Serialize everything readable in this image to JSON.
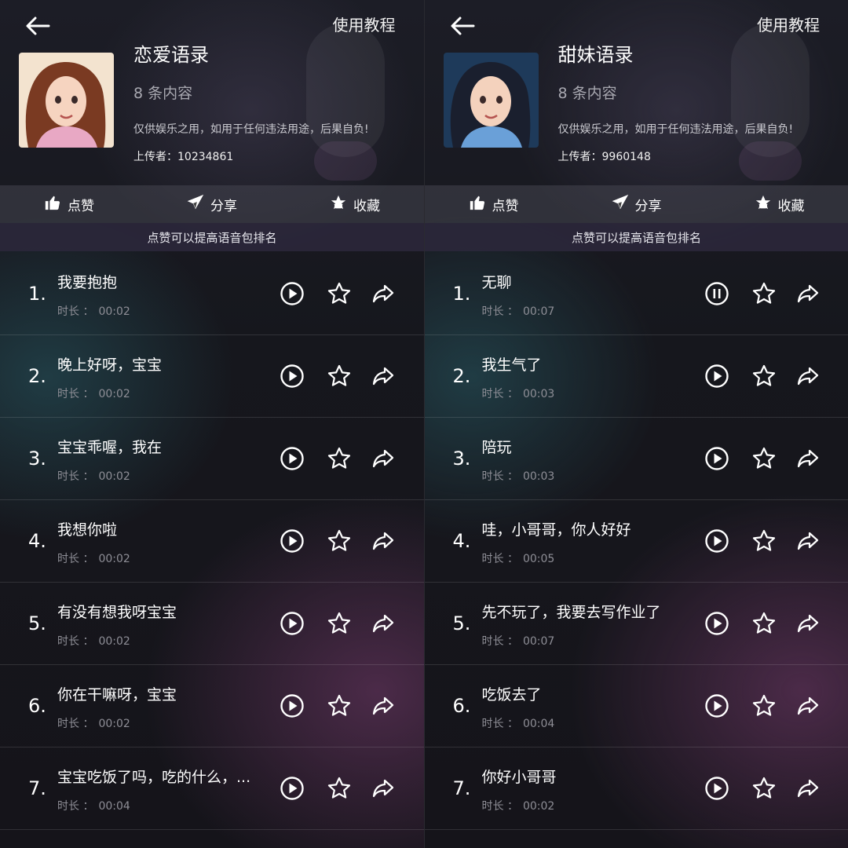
{
  "panels": [
    {
      "tutorial_label": "使用教程",
      "title": "恋爱语录",
      "count": "8 条内容",
      "disclaimer": "仅供娱乐之用，如用于任何违法用途，后果自负!",
      "uploader_label": "上传者：",
      "uploader_id": "10234861",
      "actions": {
        "like": "点赞",
        "share": "分享",
        "favorite": "收藏"
      },
      "tip": "点赞可以提高语音包排名",
      "duration_label": "时长 ：",
      "items": [
        {
          "num": "1.",
          "title": "我要抱抱",
          "duration": "00:02",
          "state": "play"
        },
        {
          "num": "2.",
          "title": "晚上好呀，宝宝",
          "duration": "00:02",
          "state": "play"
        },
        {
          "num": "3.",
          "title": "宝宝乖喔，我在",
          "duration": "00:02",
          "state": "play"
        },
        {
          "num": "4.",
          "title": "我想你啦",
          "duration": "00:02",
          "state": "play"
        },
        {
          "num": "5.",
          "title": "有没有想我呀宝宝",
          "duration": "00:02",
          "state": "play"
        },
        {
          "num": "6.",
          "title": "你在干嘛呀，宝宝",
          "duration": "00:02",
          "state": "play"
        },
        {
          "num": "7.",
          "title": "宝宝吃饭了吗，吃的什么，...",
          "duration": "00:04",
          "state": "play"
        }
      ]
    },
    {
      "tutorial_label": "使用教程",
      "title": "甜妹语录",
      "count": "8 条内容",
      "disclaimer": "仅供娱乐之用，如用于任何违法用途，后果自负!",
      "uploader_label": "上传者：",
      "uploader_id": "9960148",
      "actions": {
        "like": "点赞",
        "share": "分享",
        "favorite": "收藏"
      },
      "tip": "点赞可以提高语音包排名",
      "duration_label": "时长 ：",
      "items": [
        {
          "num": "1.",
          "title": "无聊",
          "duration": "00:07",
          "state": "pause"
        },
        {
          "num": "2.",
          "title": "我生气了",
          "duration": "00:03",
          "state": "play"
        },
        {
          "num": "3.",
          "title": "陪玩",
          "duration": "00:03",
          "state": "play"
        },
        {
          "num": "4.",
          "title": "哇，小哥哥，你人好好",
          "duration": "00:05",
          "state": "play"
        },
        {
          "num": "5.",
          "title": "先不玩了，我要去写作业了",
          "duration": "00:07",
          "state": "play"
        },
        {
          "num": "6.",
          "title": "吃饭去了",
          "duration": "00:04",
          "state": "play"
        },
        {
          "num": "7.",
          "title": "你好小哥哥",
          "duration": "00:02",
          "state": "play"
        }
      ]
    }
  ]
}
